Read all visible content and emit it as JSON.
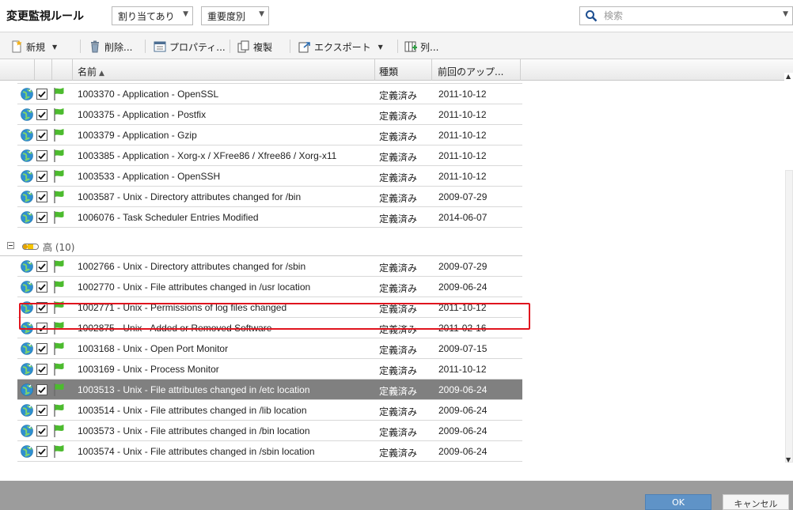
{
  "header": {
    "title": "変更監視ルール",
    "assignment_filter": "割り当てあり",
    "severity_filter": "重要度別",
    "search_placeholder": "検索"
  },
  "toolbar": {
    "new_label": "新規",
    "delete_label": "削除...",
    "properties_label": "プロパティ...",
    "duplicate_label": "複製",
    "export_label": "エクスポート",
    "columns_label": "列..."
  },
  "columns": {
    "name": "名前",
    "type": "種類",
    "last_update": "前回のアップ..."
  },
  "groups": [
    {
      "rows": [
        {
          "name": "1003370 - Application - OpenSSL",
          "type": "定義済み",
          "date": "2011-10-12"
        },
        {
          "name": "1003375 - Application - Postfix",
          "type": "定義済み",
          "date": "2011-10-12"
        },
        {
          "name": "1003379 - Application - Gzip",
          "type": "定義済み",
          "date": "2011-10-12"
        },
        {
          "name": "1003385 - Application - Xorg-x / XFree86 / Xfree86 / Xorg-x11",
          "type": "定義済み",
          "date": "2011-10-12"
        },
        {
          "name": "1003533 - Application - OpenSSH",
          "type": "定義済み",
          "date": "2011-10-12"
        },
        {
          "name": "1003587 - Unix - Directory attributes changed for /bin",
          "type": "定義済み",
          "date": "2009-07-29"
        },
        {
          "name": "1006076 - Task Scheduler Entries Modified",
          "type": "定義済み",
          "date": "2014-06-07"
        }
      ]
    },
    {
      "label": "高 (10)",
      "rows": [
        {
          "name": "1002766 - Unix - Directory attributes changed for /sbin",
          "type": "定義済み",
          "date": "2009-07-29"
        },
        {
          "name": "1002770 - Unix - File attributes changed in /usr location",
          "type": "定義済み",
          "date": "2009-06-24"
        },
        {
          "name": "1002771 - Unix - Permissions of log files changed",
          "type": "定義済み",
          "date": "2011-10-12"
        },
        {
          "name": "1002875 - Unix - Added or Removed Software",
          "type": "定義済み",
          "date": "2011-02-16"
        },
        {
          "name": "1003168 - Unix - Open Port Monitor",
          "type": "定義済み",
          "date": "2009-07-15"
        },
        {
          "name": "1003169 - Unix - Process Monitor",
          "type": "定義済み",
          "date": "2011-10-12"
        },
        {
          "name": "1003513 - Unix - File attributes changed in /etc location",
          "type": "定義済み",
          "date": "2009-06-24",
          "selected": true
        },
        {
          "name": "1003514 - Unix - File attributes changed in /lib location",
          "type": "定義済み",
          "date": "2009-06-24"
        },
        {
          "name": "1003573 - Unix - File attributes changed in /bin location",
          "type": "定義済み",
          "date": "2009-06-24"
        },
        {
          "name": "1003574 - Unix - File attributes changed in /sbin location",
          "type": "定義済み",
          "date": "2009-06-24"
        }
      ]
    }
  ],
  "footer": {
    "ok_label": "OK",
    "cancel_label": "キャンセル"
  },
  "colors": {
    "selected_row": "#808080",
    "highlight_border": "#e0141e",
    "ok_button": "#5f93c7",
    "footer_bar": "#9c9c9c"
  }
}
